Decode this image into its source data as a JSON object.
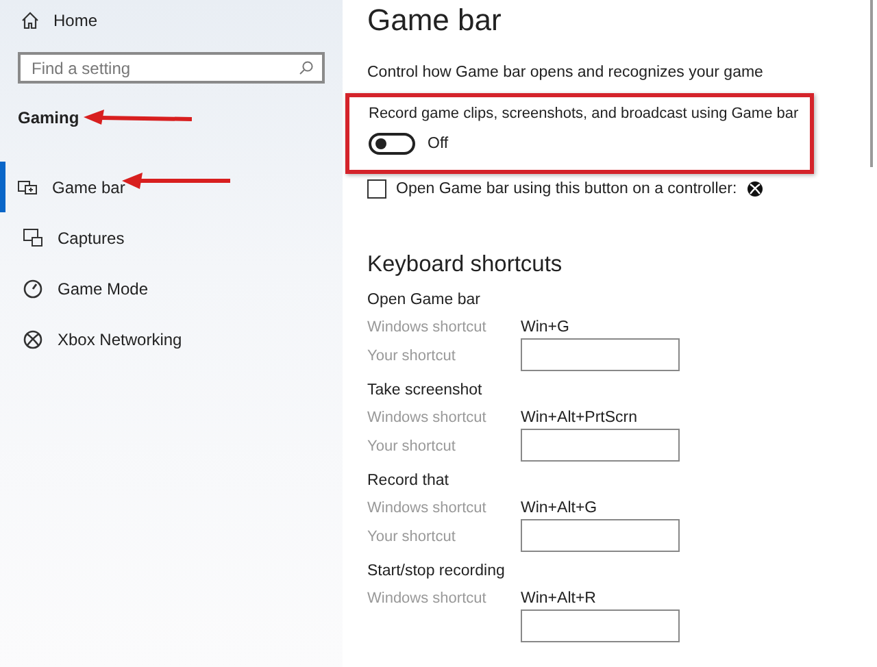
{
  "sidebar": {
    "home": "Home",
    "search": {
      "placeholder": "Find a setting"
    },
    "section": "Gaming",
    "items": [
      {
        "label": "Game bar",
        "selected": true
      },
      {
        "label": "Captures",
        "selected": false
      },
      {
        "label": "Game Mode",
        "selected": false
      },
      {
        "label": "Xbox Networking",
        "selected": false
      }
    ]
  },
  "main": {
    "title": "Game bar",
    "description": "Control how Game bar opens and recognizes your game",
    "record": {
      "label": "Record game clips, screenshots, and broadcast using Game bar",
      "on": false,
      "state_text": "Off"
    },
    "controller": {
      "label": "Open Game bar using this button on a controller:",
      "checked": false
    },
    "shortcuts_title": "Keyboard shortcuts",
    "shortcuts": [
      {
        "name": "Open Game bar",
        "windows_label": "Windows shortcut",
        "windows_value": "Win+G",
        "your_label": "Your shortcut"
      },
      {
        "name": "Take screenshot",
        "windows_label": "Windows shortcut",
        "windows_value": "Win+Alt+PrtScrn",
        "your_label": "Your shortcut"
      },
      {
        "name": "Record that",
        "windows_label": "Windows shortcut",
        "windows_value": "Win+Alt+G",
        "your_label": "Your shortcut"
      },
      {
        "name": "Start/stop recording",
        "windows_label": "Windows shortcut",
        "windows_value": "Win+Alt+R"
      }
    ]
  }
}
